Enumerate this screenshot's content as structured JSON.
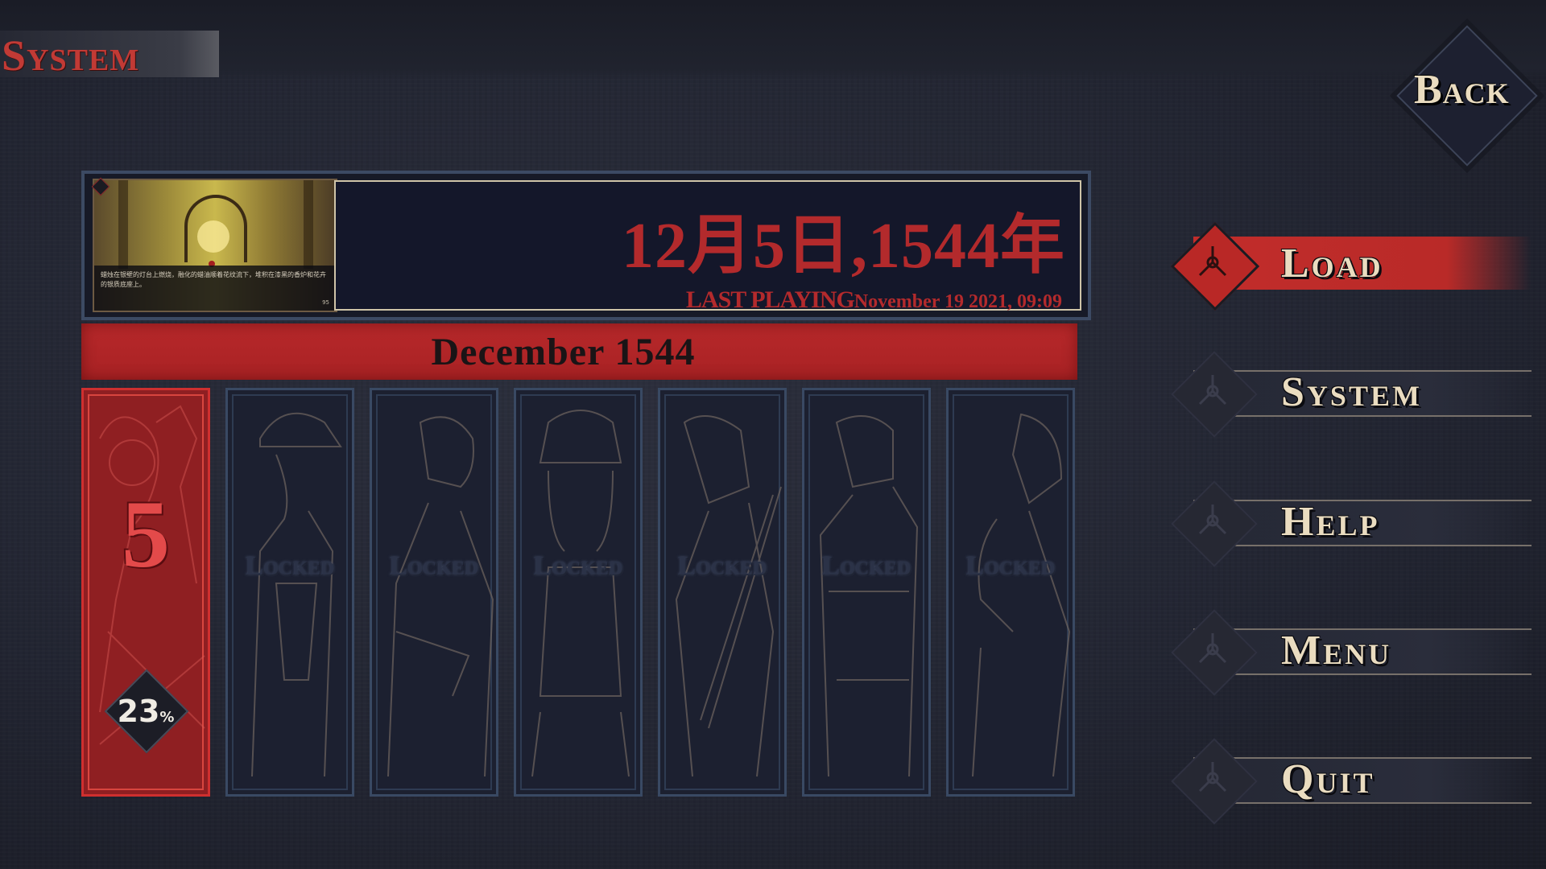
{
  "header": {
    "screen_title": "System"
  },
  "back_button": {
    "label": "Back"
  },
  "save_slot": {
    "date": "12月5日,1544年",
    "last_playing_label": "LAST PLAYING",
    "last_playing_time": "November 19 2021, 09:09",
    "thumbnail_caption": "蜡烛在银壁的灯台上燃烧，融化的蜡油顺着花纹流下，堆积在漆黑的香炉和花卉的银质底座上。",
    "thumbnail_page": "95"
  },
  "month_banner": "December  1544",
  "chapters": [
    {
      "number": "5",
      "progress": "23",
      "progress_unit": "%"
    },
    {
      "locked_label": "Locked"
    },
    {
      "locked_label": "Locked"
    },
    {
      "locked_label": "Locked"
    },
    {
      "locked_label": "Locked"
    },
    {
      "locked_label": "Locked"
    },
    {
      "locked_label": "Locked"
    }
  ],
  "menu": [
    {
      "label": "Load",
      "active": true
    },
    {
      "label": "System",
      "active": false
    },
    {
      "label": "Help",
      "active": false
    },
    {
      "label": "Menu",
      "active": false
    },
    {
      "label": "Quit",
      "active": false
    }
  ],
  "colors": {
    "accent_red": "#b92a28",
    "banner_red": "#b7282a",
    "label_cream": "#eadcc0",
    "panel_border": "#3c4a63",
    "background": "#232633"
  },
  "icons": {
    "menu_glyph": "tri-blade-emblem-icon",
    "back_diamond": "diamond-frame-icon",
    "thumbnail_marker": "bookmark-diamond-icon"
  }
}
